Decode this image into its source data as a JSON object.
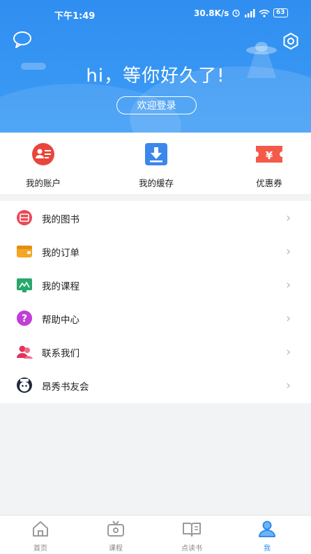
{
  "status_bar": {
    "time": "下午1:49",
    "network_speed": "30.8K/s",
    "battery": "63"
  },
  "header": {
    "greeting": "hi，等你好久了!",
    "login_button": "欢迎登录"
  },
  "quick_actions": [
    {
      "label": "我的账户",
      "icon": "account-card-icon"
    },
    {
      "label": "我的缓存",
      "icon": "download-icon"
    },
    {
      "label": "优惠券",
      "icon": "coupon-icon"
    }
  ],
  "menu": [
    {
      "label": "我的图书",
      "icon": "book-icon"
    },
    {
      "label": "我的订单",
      "icon": "wallet-icon"
    },
    {
      "label": "我的课程",
      "icon": "course-icon"
    },
    {
      "label": "帮助中心",
      "icon": "help-icon"
    },
    {
      "label": "联系我们",
      "icon": "contacts-icon"
    },
    {
      "label": "昂秀书友会",
      "icon": "club-avatar-icon"
    }
  ],
  "tabs": [
    {
      "label": "首页",
      "icon": "home-icon",
      "active": false
    },
    {
      "label": "课程",
      "icon": "tv-icon",
      "active": false
    },
    {
      "label": "点读书",
      "icon": "open-book-icon",
      "active": false
    },
    {
      "label": "我",
      "icon": "person-icon",
      "active": true
    }
  ],
  "colors": {
    "header_blue": "#3a97f3",
    "accent": "#2e8cf0",
    "account_red": "#e8463c",
    "coupon_red": "#f35a4a",
    "download_blue": "#3b87ec"
  }
}
